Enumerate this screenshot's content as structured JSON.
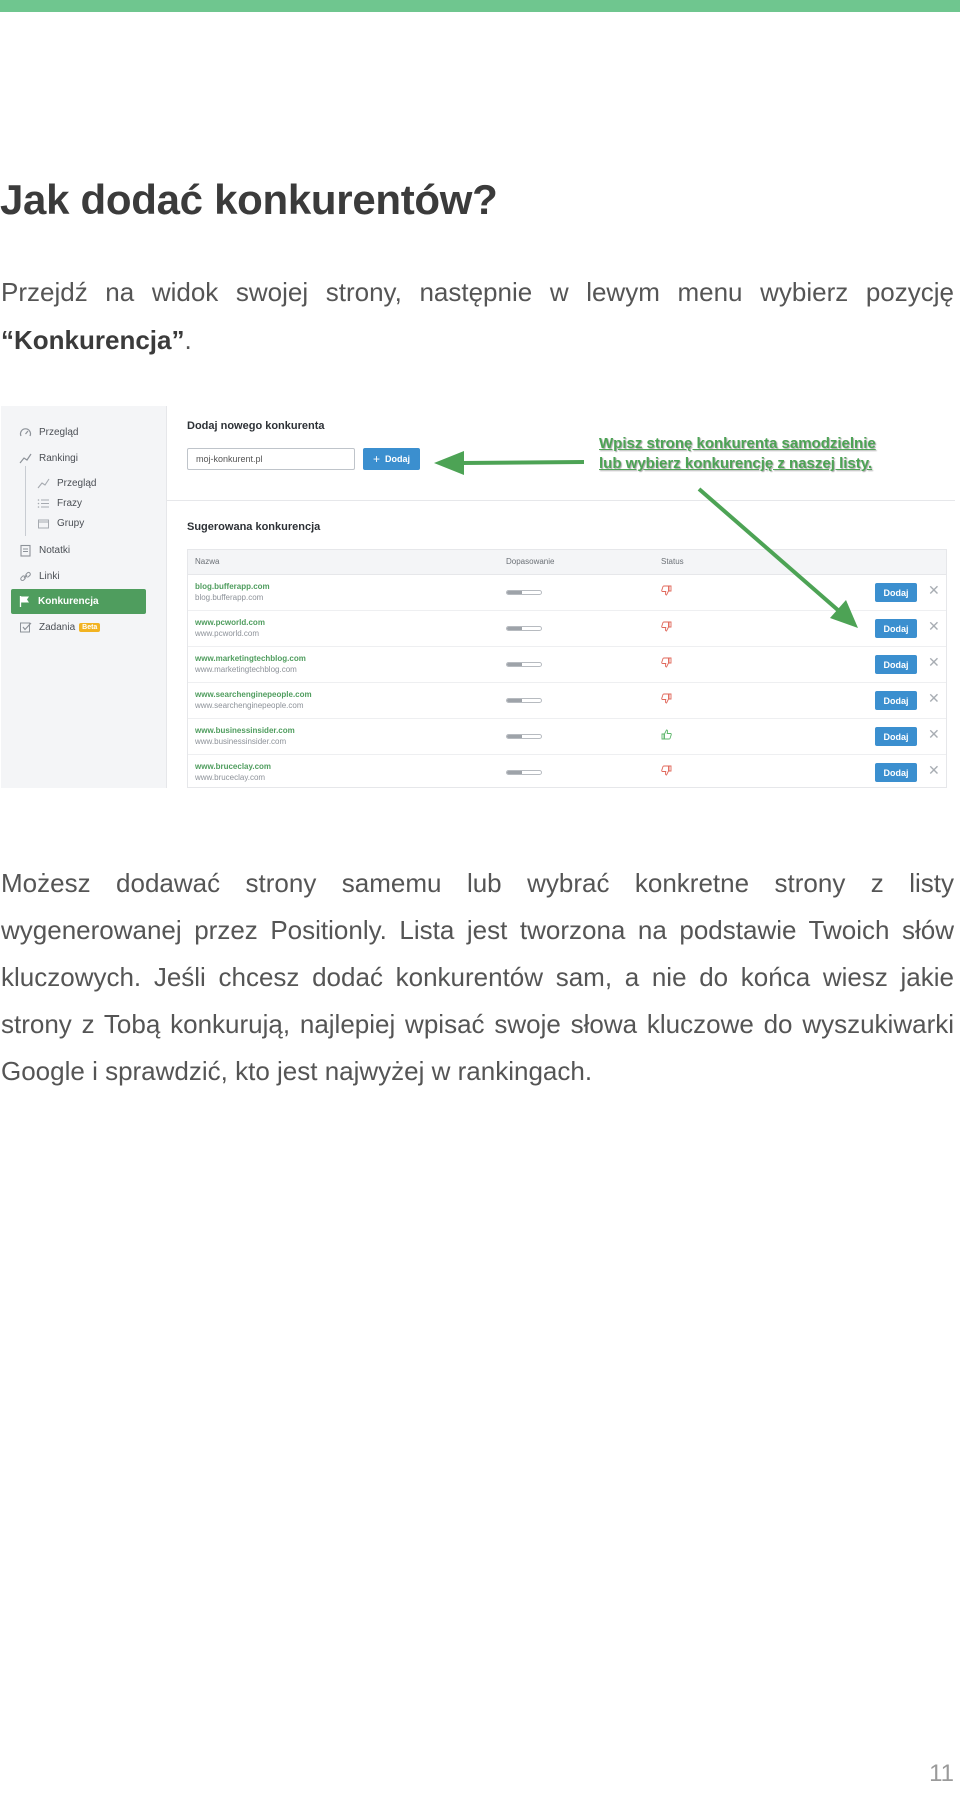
{
  "page": {
    "title": "Jak dodać konkurentów?",
    "intro_before": "Przejdź na widok swojej strony, następnie w lewym menu wybierz pozycję ",
    "intro_bold": "“Konkurencja”",
    "intro_after": ".",
    "body": "Możesz dodawać strony samemu lub wybrać konkretne strony z listy wygenerowanej przez Positionly. Lista jest tworzona na podstawie Twoich słów kluczowych. Jeśli chcesz dodać konkurentów sam, a nie do końca wiesz jakie strony z Tobą konkurują, najlepiej wpisać swoje słowa kluczowe do wyszukiwarki Google i sprawdzić, kto jest najwyżej w rankingach.",
    "page_number": "11",
    "accent_color": "#6fc68f"
  },
  "screenshot": {
    "sidebar": {
      "items": [
        {
          "label": "Przegląd",
          "icon": "gauge-icon"
        },
        {
          "label": "Rankingi",
          "icon": "chart-line-icon"
        },
        {
          "label": "Przegląd",
          "icon": "chart-line-icon"
        },
        {
          "label": "Frazy",
          "icon": "list-icon"
        },
        {
          "label": "Grupy",
          "icon": "folder-icon"
        },
        {
          "label": "Notatki",
          "icon": "notes-icon"
        },
        {
          "label": "Linki",
          "icon": "link-icon"
        },
        {
          "label": "Konkurencja",
          "icon": "flag-icon",
          "active": true
        },
        {
          "label": "Zadania",
          "icon": "checkbox-icon",
          "badge": "Beta"
        }
      ]
    },
    "add_section": {
      "title": "Dodaj nowego konkurenta",
      "input_value": "moj-konkurent.pl",
      "button_label": "Dodaj"
    },
    "callout": "Wpisz stronę konkurenta samodzielnie lub wybierz konkurencję z naszej listy.",
    "suggested": {
      "title": "Sugerowana konkurencja",
      "columns": [
        "Nazwa",
        "Dopasowanie",
        "Status"
      ],
      "rows": [
        {
          "name": "blog.bufferapp.com",
          "url": "blog.bufferapp.com",
          "match": 0.45,
          "status": "thumbs-down",
          "action": "Dodaj"
        },
        {
          "name": "www.pcworld.com",
          "url": "www.pcworld.com",
          "match": 0.45,
          "status": "thumbs-down",
          "action": "Dodaj"
        },
        {
          "name": "www.marketingtechblog.com",
          "url": "www.marketingtechblog.com",
          "match": 0.45,
          "status": "thumbs-down",
          "action": "Dodaj"
        },
        {
          "name": "www.searchenginepeople.com",
          "url": "www.searchenginepeople.com",
          "match": 0.45,
          "status": "thumbs-down",
          "action": "Dodaj"
        },
        {
          "name": "www.businessinsider.com",
          "url": "www.businessinsider.com",
          "match": 0.45,
          "status": "thumbs-up",
          "action": "Dodaj"
        },
        {
          "name": "www.bruceclay.com",
          "url": "www.bruceclay.com",
          "match": 0.45,
          "status": "thumbs-down",
          "action": "Dodaj"
        }
      ],
      "status_colors": {
        "thumbs-down": "#e0675a",
        "thumbs-up": "#5cb66a"
      }
    }
  }
}
